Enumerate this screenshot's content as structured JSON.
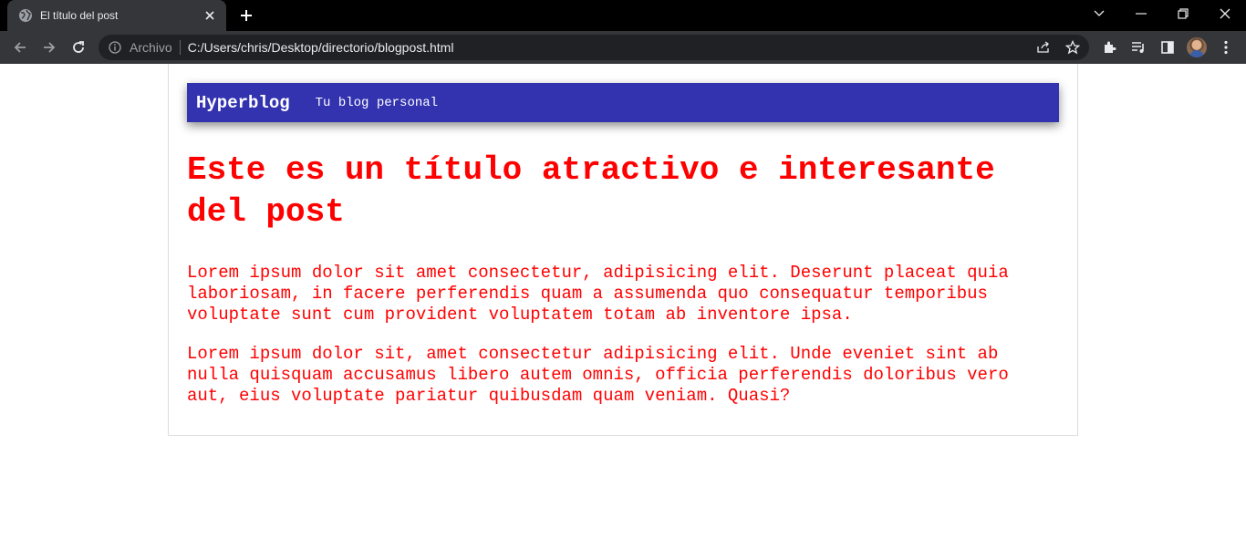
{
  "browser": {
    "tab": {
      "title": "El título del post",
      "favicon": "globe-icon",
      "close_icon": "close-icon"
    },
    "new_tab_icon": "plus-icon",
    "window_controls": [
      "tab-search-icon",
      "minimize-icon",
      "restore-icon",
      "close-icon"
    ],
    "toolbar": {
      "back_icon": "back-arrow-icon",
      "forward_icon": "forward-arrow-icon",
      "reload_icon": "reload-icon",
      "omnibox": {
        "info_icon": "info-icon",
        "chip_label": "Archivo",
        "url": "C:/Users/chris/Desktop/directorio/blogpost.html",
        "share_icon": "share-icon",
        "bookmark_icon": "star-icon"
      },
      "right_icons": [
        "extensions-icon",
        "media-icon",
        "side-panel-icon",
        "avatar",
        "menu-icon"
      ]
    },
    "colors": {
      "tabstrip": "#000000",
      "active_tab": "#35363a",
      "omnibox": "#202124"
    }
  },
  "page": {
    "header": {
      "brand": "Hyperblog",
      "tagline": "Tu blog personal"
    },
    "post": {
      "title": "Este es un título atractivo e interesante del post",
      "paragraphs": [
        "Lorem ipsum dolor sit amet consectetur, adipisicing elit. Deserunt placeat quia laboriosam, in facere perferendis quam a assumenda quo consequatur temporibus voluptate sunt cum provident voluptatem totam ab inventore ipsa.",
        "Lorem ipsum dolor sit, amet consectetur adipisicing elit. Unde eveniet sint ab nulla quisquam accusamus libero autem omnis, officia perferendis doloribus vero aut, eius voluptate pariatur quibusdam quam veniam. Quasi?"
      ]
    },
    "colors": {
      "header_bg": "#3333b0",
      "text": "#ff0000",
      "container_border": "#dcdcdc"
    }
  }
}
